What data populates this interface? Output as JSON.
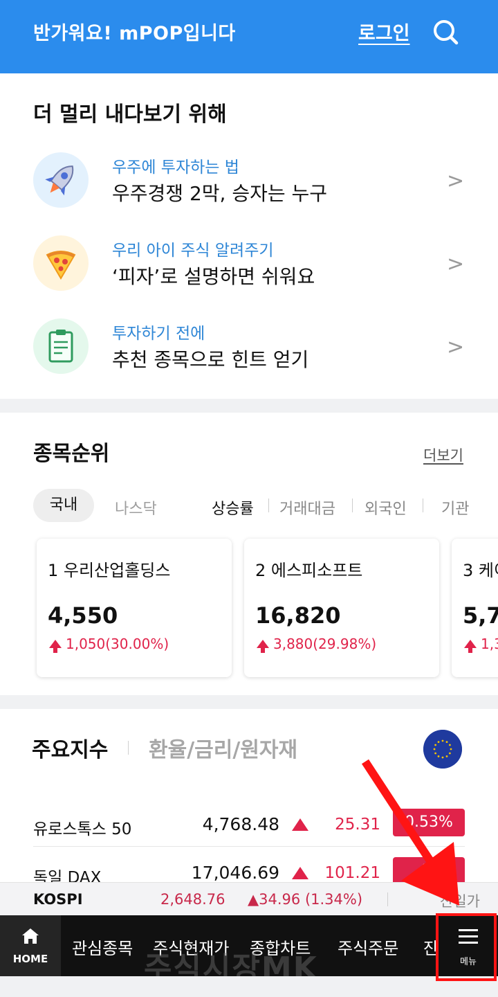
{
  "header": {
    "greeting": "반가워요! mPOP입니다",
    "login_label": "로그인",
    "search_icon": "search-icon"
  },
  "features": {
    "title": "더 멀리 내다보기 위해",
    "items": [
      {
        "subtitle": "우주에 투자하는 법",
        "title": "우주경쟁 2막, 승자는 누구",
        "icon": "rocket-icon",
        "bg": "#e3f1fd"
      },
      {
        "subtitle": "우리 아이 주식 알려주기",
        "title": "‘피자’로 설명하면 쉬워요",
        "icon": "pizza-icon",
        "bg": "#fff4dc"
      },
      {
        "subtitle": "투자하기 전에",
        "title": "추천 종목으로 힌트 얻기",
        "icon": "clipboard-icon",
        "bg": "#e4f8ec"
      }
    ],
    "chevron": ">"
  },
  "ranking": {
    "title": "종목순위",
    "more_label": "더보기",
    "market_tabs": [
      "국내",
      "나스닥"
    ],
    "sort_tabs": [
      "상승률",
      "거래대금",
      "외국인",
      "기관"
    ],
    "cards": [
      {
        "name": "1 우리산업홀딩스",
        "price": "4,550",
        "change": "1,050(30.00%)"
      },
      {
        "name": "2 에스피소프트",
        "price": "16,820",
        "change": "3,880(29.98%)"
      },
      {
        "name": "3 케이",
        "price": "5,7",
        "change": "1,3"
      }
    ]
  },
  "indices": {
    "tab_main": "주요지수",
    "tab_alt": "환율/금리/원자재",
    "flag_icon": "eu-flag-icon",
    "rows": [
      {
        "name": "유로스톡스 50",
        "value": "4,768.48",
        "change": "25.31",
        "percent": "0.53%"
      },
      {
        "name": "독일 DAX",
        "value": "17,046.69",
        "change": "101.21",
        "percent": "%"
      }
    ]
  },
  "ticker": {
    "name": "KOSPI",
    "value": "2,648.76",
    "change": "▲34.96 (1.34%)",
    "extra": "산일가"
  },
  "bottom_nav": {
    "home_label": "HOME",
    "items": [
      "관심종목",
      "주식현재가",
      "종합차트",
      "주식주문",
      "잔"
    ],
    "menu_label": "메뉴"
  },
  "watermark": "주식시장MK",
  "colors": {
    "brand_blue": "#2b8ced",
    "up_red": "#e0234a",
    "annotation_red": "#ff1414"
  }
}
